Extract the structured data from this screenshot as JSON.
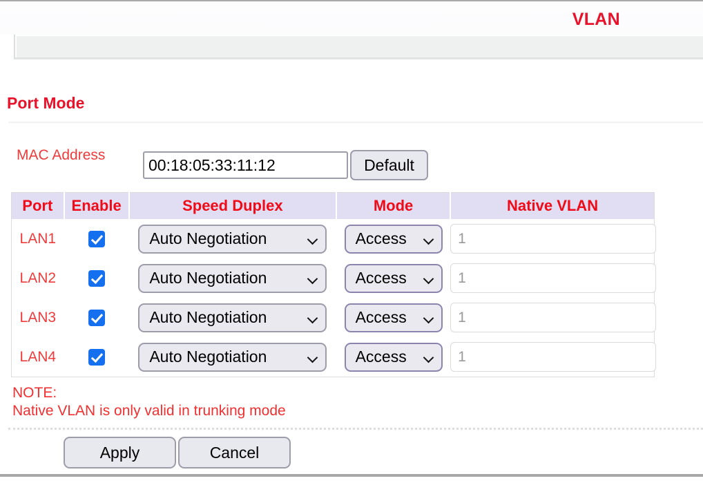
{
  "header": {
    "title": "VLAN"
  },
  "section": {
    "title": "Port Mode"
  },
  "mac": {
    "label": "MAC Address",
    "value": "00:18:05:33:11:12",
    "default_button": "Default"
  },
  "table": {
    "columns": [
      "Port",
      "Enable",
      "Speed Duplex",
      "Mode",
      "Native VLAN"
    ],
    "rows": [
      {
        "port": "LAN1",
        "enabled": true,
        "speed_duplex": "Auto Negotiation",
        "mode": "Access",
        "native_vlan": "",
        "native_vlan_placeholder": "1"
      },
      {
        "port": "LAN2",
        "enabled": true,
        "speed_duplex": "Auto Negotiation",
        "mode": "Access",
        "native_vlan": "",
        "native_vlan_placeholder": "1"
      },
      {
        "port": "LAN3",
        "enabled": true,
        "speed_duplex": "Auto Negotiation",
        "mode": "Access",
        "native_vlan": "",
        "native_vlan_placeholder": "1"
      },
      {
        "port": "LAN4",
        "enabled": true,
        "speed_duplex": "Auto Negotiation",
        "mode": "Access",
        "native_vlan": "",
        "native_vlan_placeholder": "1"
      }
    ],
    "speed_options": [
      "Auto Negotiation"
    ],
    "mode_options": [
      "Access"
    ]
  },
  "note": {
    "label": "NOTE:",
    "text": "Native VLAN is only valid in trunking mode"
  },
  "footer": {
    "apply": "Apply",
    "cancel": "Cancel"
  },
  "colors": {
    "accent_red": "#e8122a",
    "text_red": "#ef3b3b",
    "header_bg": "#e1ddf3",
    "checkbox_blue": "#1570ef"
  }
}
